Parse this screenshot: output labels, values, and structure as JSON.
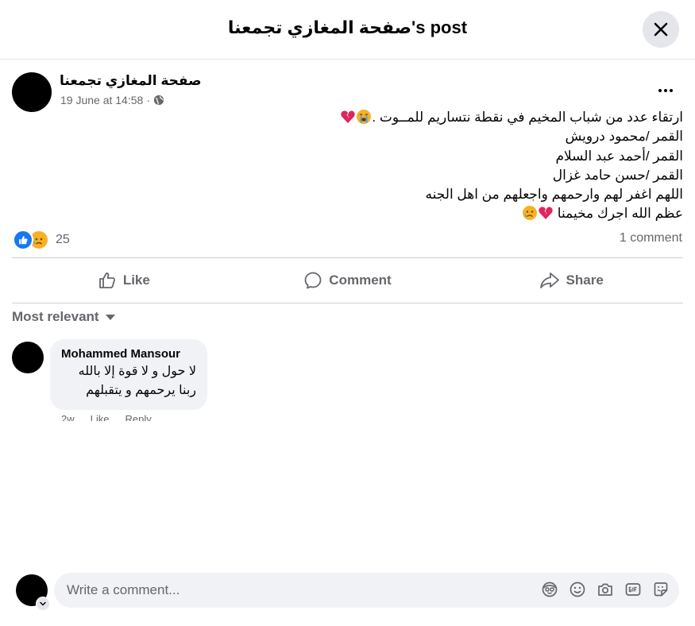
{
  "header": {
    "title": "صفحة المغازي تجمعنا's post"
  },
  "post": {
    "author": "صفحة المغازي تجمعنا",
    "timestamp": "19 June at 14:58",
    "separator": "·",
    "privacy_icon": "globe-icon",
    "lines": [
      "ارتقاء عدد من شباب المخيم في نقطة نتساريم للمــوت .",
      "القمر /محمود درويش",
      "القمر /أحمد عبد السلام",
      "القمر /حسن حامد غزال",
      "اللهم اغفر لهم وارحمهم واجعلهم من اهل الجنه",
      "عظم الله اجرك مخيمنا "
    ],
    "reaction_count": "25",
    "comment_count": "1 comment"
  },
  "actions": {
    "like": "Like",
    "comment": "Comment",
    "share": "Share"
  },
  "comments": {
    "sort_label": "Most relevant",
    "items": [
      {
        "author": "Mohammed Mansour",
        "lines": [
          "لا حول و لا قوة إلا بالله",
          "ربنا يرحمهم و يتقبلهم"
        ],
        "time": "2w",
        "like": "Like",
        "reply": "Reply"
      }
    ]
  },
  "composer": {
    "placeholder": "Write a comment..."
  },
  "colors": {
    "accent": "#1877f2",
    "secondary_text": "#65676b",
    "bubble": "#f0f2f5",
    "divider": "#ced0d4"
  }
}
